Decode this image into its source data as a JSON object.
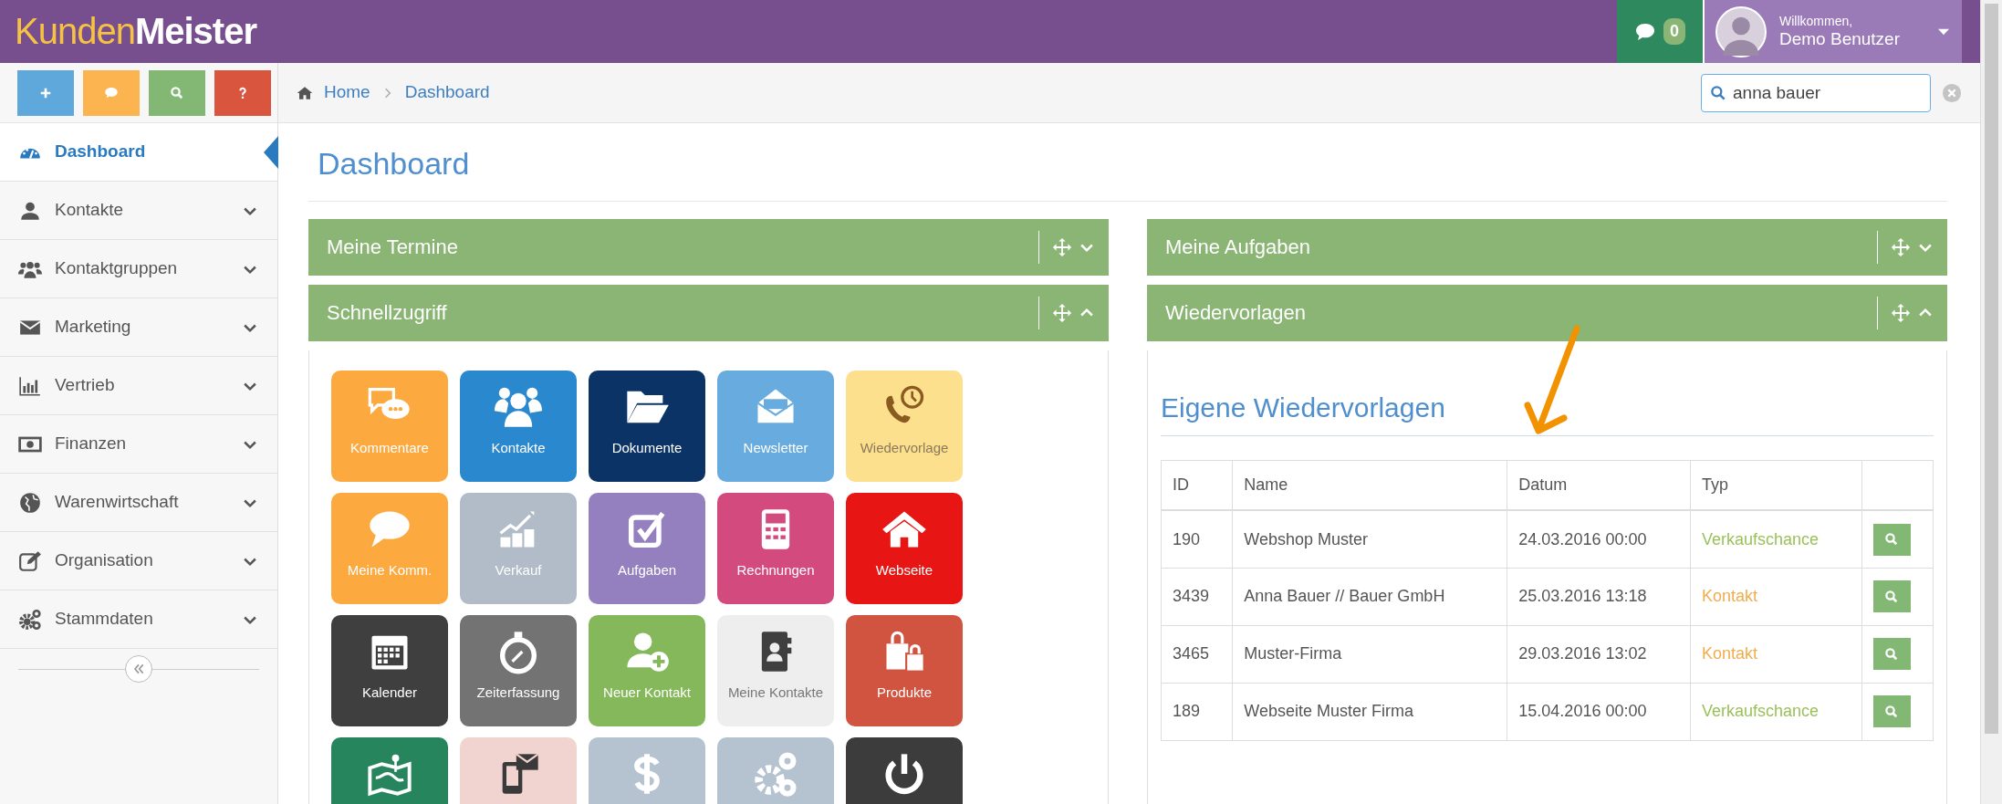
{
  "header": {
    "logo_light": "Kunden",
    "logo_bold": "Meister",
    "message_count": "0",
    "user": {
      "greeting": "Willkommen,",
      "name": "Demo Benutzer"
    }
  },
  "quick_buttons": [
    {
      "color": "#5fa8dc"
    },
    {
      "color": "#fbb450"
    },
    {
      "color": "#82b874"
    },
    {
      "color": "#d9553e"
    }
  ],
  "breadcrumb": [
    {
      "label": "Home"
    },
    {
      "label": "Dashboard"
    }
  ],
  "search": {
    "value": "anna bauer"
  },
  "sidebar": {
    "items": [
      {
        "label": "Dashboard",
        "selected": true
      },
      {
        "label": "Kontakte",
        "selected": false,
        "expanded": false
      },
      {
        "label": "Kontaktgruppen",
        "selected": false,
        "expanded": false
      },
      {
        "label": "Marketing",
        "selected": false,
        "expanded": false
      },
      {
        "label": "Vertrieb",
        "selected": false,
        "expanded": false
      },
      {
        "label": "Finanzen",
        "selected": false,
        "expanded": false
      },
      {
        "label": "Warenwirtschaft",
        "selected": false,
        "expanded": false
      },
      {
        "label": "Organisation",
        "selected": false,
        "expanded": false
      },
      {
        "label": "Stammdaten",
        "selected": false,
        "expanded": false
      }
    ]
  },
  "page_title": "Dashboard",
  "columns": [
    [
      {
        "title": "Meine Termine",
        "expanded": false
      },
      {
        "title": "Schnellzugriff",
        "expanded": true,
        "tiles": [
          {
            "label": "Kommentare",
            "color": "#fcaa40"
          },
          {
            "label": "Kontakte",
            "color": "#2a88cf"
          },
          {
            "label": "Dokumente",
            "color": "#0b3366"
          },
          {
            "label": "Newsletter",
            "color": "#68acdf"
          },
          {
            "label": "Wiedervorlage",
            "color": "#fde08e"
          },
          {
            "label": "Meine Komm.",
            "color": "#fcaa40"
          },
          {
            "label": "Verkauf",
            "color": "#b1bcc8"
          },
          {
            "label": "Aufgaben",
            "color": "#9580bf"
          },
          {
            "label": "Rechnungen",
            "color": "#d34b7e"
          },
          {
            "label": "Webseite",
            "color": "#e81515"
          },
          {
            "label": "Kalender",
            "color": "#3f3f3f"
          },
          {
            "label": "Zeiterfassung",
            "color": "#737373"
          },
          {
            "label": "Neuer Kontakt",
            "color": "#84b85a"
          },
          {
            "label": "Meine Kontakte",
            "color": "#eeeeee"
          },
          {
            "label": "Produkte",
            "color": "#d05440"
          },
          {
            "color": "#26855c"
          },
          {
            "color": "#f1d4cf"
          },
          {
            "color": "#b5c3d0"
          },
          {
            "color": "#b5c3d0"
          },
          {
            "color": "#3c3c3c"
          }
        ]
      }
    ],
    [
      {
        "title": "Meine Aufgaben",
        "expanded": false
      },
      {
        "title": "Wiedervorlagen",
        "expanded": true,
        "subtitle": "Eigene Wiedervorlagen",
        "table": {
          "columns": [
            "ID",
            "Name",
            "Datum",
            "Typ"
          ],
          "rows": [
            {
              "id": "190",
              "name": "Webshop Muster",
              "date": "24.03.2016 00:00",
              "type": "Verkaufschance",
              "color": "#9bc15a"
            },
            {
              "id": "3439",
              "name": "Anna Bauer // Bauer GmbH",
              "date": "25.03.2016 13:18",
              "type": "Kontakt",
              "color": "#f0ad4e"
            },
            {
              "id": "3465",
              "name": "Muster-Firma",
              "date": "29.03.2016 13:02",
              "type": "Kontakt",
              "color": "#f0ad4e"
            },
            {
              "id": "189",
              "name": "Webseite Muster Firma",
              "date": "15.04.2016 00:00",
              "type": "Verkaufschance",
              "color": "#9bc15a"
            }
          ]
        }
      }
    ]
  ]
}
